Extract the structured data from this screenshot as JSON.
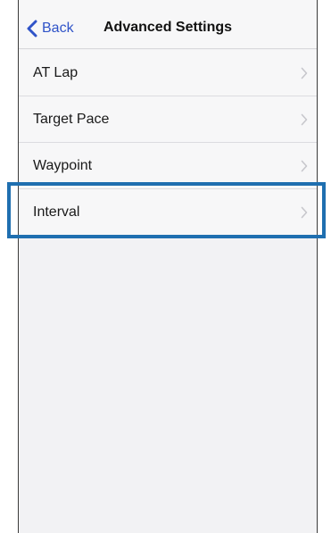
{
  "navbar": {
    "back_label": "Back",
    "title": "Advanced Settings"
  },
  "settings": {
    "items": [
      {
        "label": "AT Lap"
      },
      {
        "label": "Target Pace"
      },
      {
        "label": "Waypoint"
      },
      {
        "label": "Interval"
      }
    ]
  },
  "colors": {
    "accent": "#2f53c8",
    "highlight_border": "#1f6fb0",
    "background": "#f2f2f4",
    "chevron": "#c7c7cc"
  },
  "icons": {
    "back": "chevron-left-icon",
    "row": "chevron-right-icon"
  }
}
